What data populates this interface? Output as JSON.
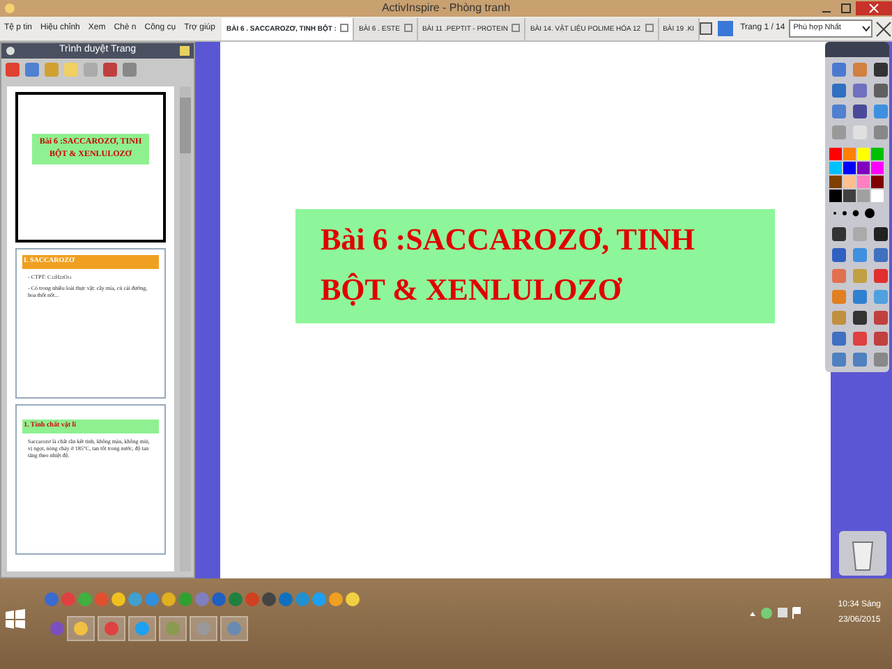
{
  "window": {
    "title": "ActivInspire - Phòng tranh"
  },
  "menu": [
    "Tệ p tin",
    "Hiệu chỉnh",
    "Xem",
    "Chè n",
    "Công cụ",
    "Trợ giúp"
  ],
  "tabs": [
    {
      "label": "BÀI 6 . SACCAROZƠ, TINH BỘT :",
      "selected": true
    },
    {
      "label": "BÀI 6 . ESTE",
      "selected": false
    },
    {
      "label": "BÀI 11 .PEPTIT - PROTEIN",
      "selected": false
    },
    {
      "label": "BÀI 14. VẬT LIỆU POLIME HÓA 12",
      "selected": false
    },
    {
      "label": "BÀI 19 .KI",
      "selected": false
    }
  ],
  "page_indicator": "Trang 1 / 14",
  "zoom": {
    "value": "Phù hợp Nhất"
  },
  "page_browser": {
    "title": "Trình duyệt Trang",
    "pages": [
      {
        "selected": true,
        "title": "Bài 6 :SACCAROZƠ, TINH BỘT & XENLULOZƠ"
      },
      {
        "selected": false,
        "title": "I. SACCAROZƠ",
        "lines": [
          "- CTPT: C$_{12}$H$_{22}$O$_{11}$",
          "- Có trong nhiều loài thực vật: cây mía, củ cải đường, hoa thốt nốt..."
        ]
      },
      {
        "selected": false,
        "title": "1. Tính chất vật lí",
        "lines": [
          "Saccarozơ là chất rắn kết tinh, không màu, không mùi, vị ngọt, nóng chảy ở 185°C, tan tốt trong nước, độ tan tăng theo nhiệt độ."
        ]
      }
    ]
  },
  "slide": {
    "title_lines": [
      "Bài 6 :SACCAROZƠ, TINH",
      "BỘT & XENLULOZƠ"
    ]
  },
  "palette": [
    {
      "color": "#ff0000"
    },
    {
      "color": "#ff8000"
    },
    {
      "color": "#ffff00"
    },
    {
      "color": "#00c000"
    },
    {
      "color": "#00c0ff"
    },
    {
      "color": "#0000ff"
    },
    {
      "color": "#8000c0"
    },
    {
      "color": "#ff00ff"
    },
    {
      "color": "#804000"
    },
    {
      "color": "#ffc090"
    },
    {
      "color": "#ff80c0"
    },
    {
      "color": "#800000"
    },
    {
      "color": "#000000"
    },
    {
      "color": "#404040"
    },
    {
      "color": "#a0a0a0"
    },
    {
      "color": "#ffffff"
    }
  ],
  "taskbar": {
    "time": "10:34 Sáng",
    "date": "23/06/2015"
  }
}
